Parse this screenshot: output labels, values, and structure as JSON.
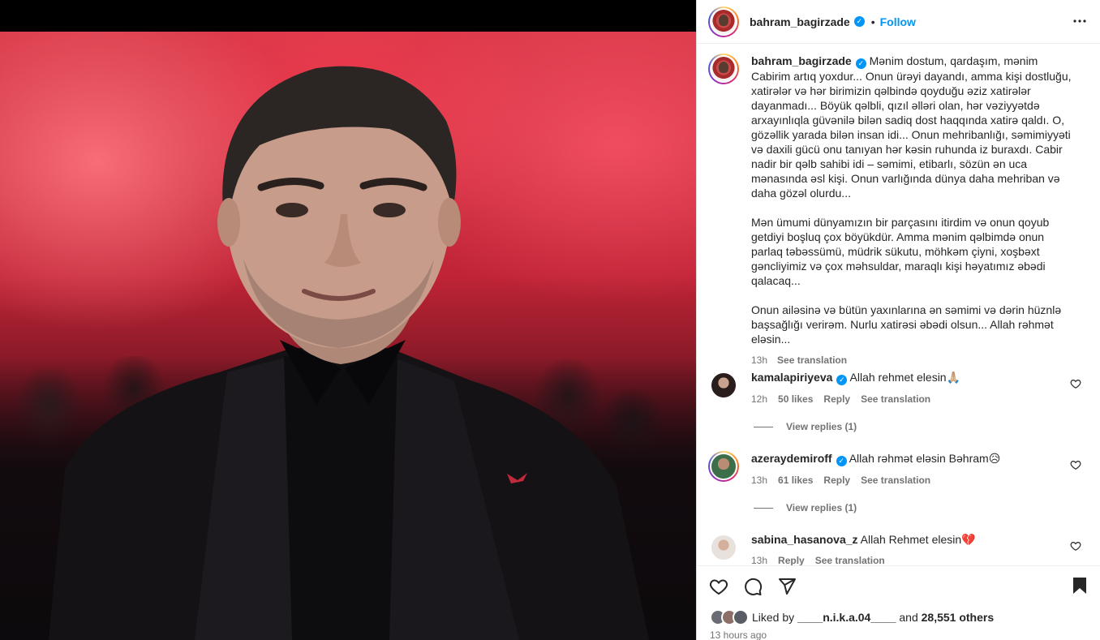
{
  "post": {
    "author": "bahram_bagirzade",
    "follow_label": "Follow",
    "dot": "•",
    "caption_paragraphs": [
      "Mənim dostum, qardaşım, mənim Cabirim artıq yoxdur... Onun ürəyi dayandı, amma kişi dostluğu, xatirələr və hər birimizin qəlbində qoyduğu əziz xatirələr dayanmadı... Böyük qəlbli, qızıl əlləri olan, hər vəziyyətdə arxayınlıqla güvənilə bilən sadiq dost haqqında xatirə qaldı. O, gözəllik yarada bilən insan idi... Onun mehribanlığı, səmimiyyəti və daxili gücü onu tanıyan hər kəsin ruhunda iz buraxdı. Cabir nadir bir qəlb sahibi idi – səmimi, etibarlı, sözün ən uca mənasında əsl kişi. Onun varlığında dünya daha mehriban və daha gözəl olurdu...",
      "Mən ümumi dünyamızın bir parçasını itirdim və onun qoyub getdiyi boşluq çox böyükdür. Amma mənim qəlbimdə onun parlaq təbəssümü, müdrik sükutu, möhkəm çiyni, xoşbəxt gəncliyimiz və çox məhsuldar, maraqlı kişi həyatımız əbədi qalacaq...",
      "Onun ailəsinə və bütün yaxınlarına ən səmimi və dərin hüznlə başsağlığı verirəm. Nurlu xatirəsi əbədi olsun... Allah rəhmət eləsin..."
    ],
    "caption_time": "13h",
    "see_translation": "See translation"
  },
  "comments": [
    {
      "user": "kamalapiriyeva",
      "text": "Allah rehmet elesin🙏🏼",
      "time": "12h",
      "likes": "50 likes",
      "reply": "Reply",
      "translate": "See translation",
      "view_replies": "View replies (1)"
    },
    {
      "user": "azeraydemiroff",
      "text": "Allah rəhmət eləsin Bəhram😥",
      "time": "13h",
      "likes": "61 likes",
      "reply": "Reply",
      "translate": "See translation",
      "view_replies": "View replies (1)"
    },
    {
      "user": "sabina_hasanova_z",
      "text": "Allah Rehmet elesin💔",
      "time": "13h",
      "reply": "Reply",
      "translate": "See translation"
    }
  ],
  "footer": {
    "liked_by_prefix": "Liked by",
    "liked_by_user": "____n.i.k.a.04____",
    "and": "and",
    "others": "28,551 others",
    "time_ago": "13 hours ago"
  },
  "colors": {
    "accent": "#0095f6",
    "secondary_text": "#737373",
    "primary_text": "#262626"
  },
  "icons": [
    "more-options-icon",
    "verified-badge-icon",
    "heart-icon",
    "comment-icon",
    "share-icon",
    "bookmark-icon"
  ]
}
